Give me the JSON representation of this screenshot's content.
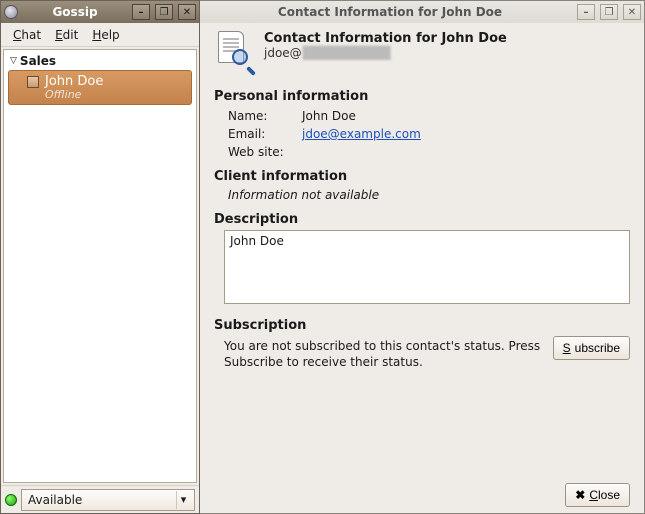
{
  "left": {
    "title": "Gossip",
    "menu": {
      "chat": "Chat",
      "edit": "Edit",
      "help": "Help"
    },
    "group": "Sales",
    "contact": {
      "name": "John Doe",
      "status": "Offline"
    },
    "presence": {
      "label": "Available"
    }
  },
  "right": {
    "title": "Contact Information for John Doe",
    "header": {
      "title": "Contact Information for John Doe",
      "jid_prefix": "jdoe@"
    },
    "personal": {
      "heading": "Personal information",
      "name_label": "Name:",
      "name_value": "John Doe",
      "email_label": "Email:",
      "email_value": "jdoe@example.com",
      "website_label": "Web site:",
      "website_value": ""
    },
    "client": {
      "heading": "Client information",
      "na": "Information not available"
    },
    "description": {
      "heading": "Description",
      "value": "John Doe"
    },
    "subscription": {
      "heading": "Subscription",
      "text": "You are not subscribed to this contact's status. Press Subscribe to receive their status.",
      "subscribe_label": "Subscribe"
    },
    "close_label": "Close"
  }
}
